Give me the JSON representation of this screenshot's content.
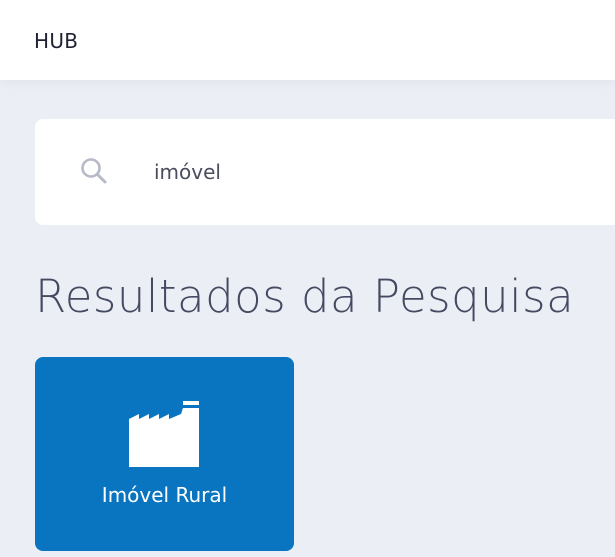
{
  "header": {
    "brand": "HUB"
  },
  "search": {
    "value": "imóvel",
    "icon": "search-icon"
  },
  "main": {
    "title": "Resultados da Pesquisa",
    "results": [
      {
        "label": "Imóvel Rural",
        "icon": "factory-icon",
        "color": "#0975c0"
      }
    ]
  },
  "colors": {
    "background": "#eceef6",
    "surface": "#ffffff",
    "accent": "#0975c0",
    "title": "#454a61"
  }
}
